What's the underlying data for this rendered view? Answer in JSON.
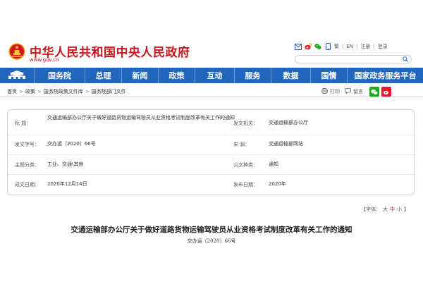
{
  "header": {
    "title": "中华人民共和国中央人民政府",
    "domain": "www.gov.cn",
    "tools": [
      "繁",
      "EN",
      "注册",
      "登录"
    ],
    "tool_separator": "|",
    "search_placeholder": ""
  },
  "nav": {
    "items": [
      "国务院",
      "总理",
      "新闻",
      "政策",
      "互动",
      "服务",
      "数据",
      "国情",
      "国家政务服务平台"
    ]
  },
  "breadcrumb": {
    "items": [
      "首页",
      "政策",
      "国务院政策文件库",
      "国务院部门文件"
    ],
    "separator": ">",
    "print_label": "打印",
    "favorite_label": "留言"
  },
  "info": {
    "title_label": "标      题：",
    "title_value": "交通运输部办公厅关于做好道路货物运输驾驶员从业资格考试制度改革有关工作的通知",
    "issuer_label": "发文机关：",
    "issuer_value": "交通运输部办公厅",
    "doc_no_label": "发文字号：",
    "doc_no_value": "交办运〔2020〕66号",
    "source_label": "来      源：",
    "source_value": "交通运输部网站",
    "topic_label": "主题分类：",
    "topic_value": "工业、交通\\其他",
    "genre_label": "公文种类：",
    "genre_value": "通知",
    "created_label": "成文日期：",
    "created_value": "2020年12月14日",
    "published_label": "发布日期：",
    "published_value": "2020年"
  },
  "font_size": {
    "label": "【字体：",
    "large": "大",
    "medium": "中",
    "small": "小",
    "close": "】"
  },
  "article": {
    "title": "交通运输部办公厅关于做好道路货物运输驾驶员从业资格考试制度改革有关工作的通知",
    "doc_no": "交办运〔2020〕66号"
  },
  "colors": {
    "brand_red": "#c8161d",
    "nav_blue": "#2066bf"
  }
}
